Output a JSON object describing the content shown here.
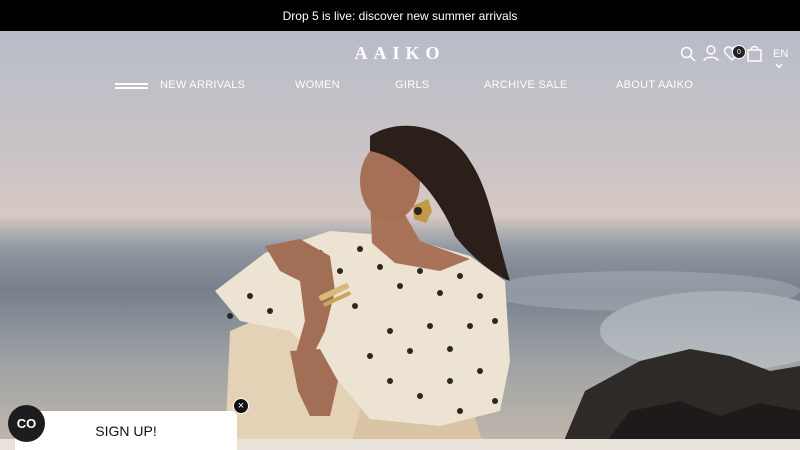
{
  "announcement": {
    "text": "Drop 5 is live: discover new summer arrivals"
  },
  "header": {
    "logo": "AAIKO",
    "wishlist_count": "0",
    "language": "EN",
    "icons": [
      "search-icon",
      "account-icon",
      "wishlist-heart-icon",
      "cart-bag-icon",
      "chevron-down-icon",
      "menu-icon"
    ]
  },
  "nav": {
    "items": [
      {
        "label": "NEW ARRIVALS"
      },
      {
        "label": "WOMEN"
      },
      {
        "label": "GIRLS"
      },
      {
        "label": "ARCHIVE SALE"
      },
      {
        "label": "ABOUT AAIKO"
      }
    ]
  },
  "popup": {
    "signup_label": "SIGN UP!",
    "close_symbol": "×"
  },
  "cookie_badge": {
    "label": "CO"
  },
  "colors": {
    "announcement_bg": "#000000",
    "text_on_hero": "#ffffff"
  }
}
